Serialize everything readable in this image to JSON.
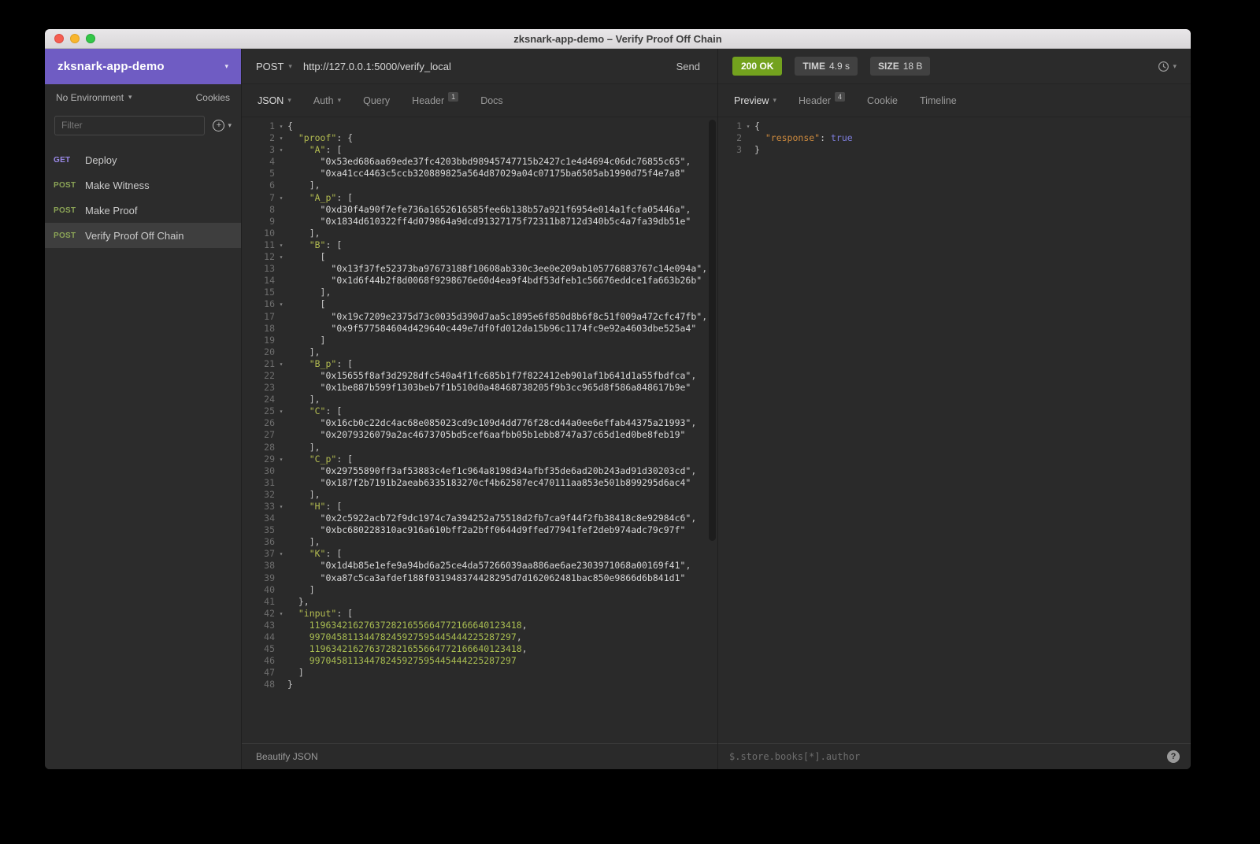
{
  "colors": {
    "accent_purple": "#6f5cc3",
    "method_get": "#9a89e8",
    "method_post": "#8ba456",
    "status_green": "#73a21e",
    "editor_key": "#b4bd51",
    "editor_string": "#d8d8d8",
    "editor_number": "#a9bd51",
    "editor_punct": "#c4c4c4",
    "response_key": "#cf8b3e",
    "response_bool": "#7d7ddc"
  },
  "window": {
    "title": "zksnark-app-demo – Verify Proof Off Chain"
  },
  "sidebar": {
    "workspace": "zksnark-app-demo",
    "environment": "No Environment",
    "cookies": "Cookies",
    "filter_placeholder": "Filter",
    "requests": [
      {
        "method": "GET",
        "name": "Deploy"
      },
      {
        "method": "POST",
        "name": "Make Witness"
      },
      {
        "method": "POST",
        "name": "Make Proof"
      },
      {
        "method": "POST",
        "name": "Verify Proof Off Chain"
      }
    ]
  },
  "request_panel": {
    "method": "POST",
    "url": "http://127.0.0.1:5000/verify_local",
    "send": "Send",
    "tabs": [
      {
        "label": "JSON"
      },
      {
        "label": "Auth"
      },
      {
        "label": "Query"
      },
      {
        "label": "Header",
        "badge": "1"
      },
      {
        "label": "Docs"
      }
    ],
    "beautify": "Beautify JSON",
    "body_lines": [
      {
        "num": 1,
        "f": true,
        "t": [
          [
            "p",
            "{"
          ]
        ]
      },
      {
        "num": 2,
        "f": true,
        "t": [
          [
            "ws",
            "  "
          ],
          [
            "k",
            "\"proof\""
          ],
          [
            "p",
            ": {"
          ]
        ]
      },
      {
        "num": 3,
        "f": true,
        "t": [
          [
            "ws",
            "    "
          ],
          [
            "k",
            "\"A\""
          ],
          [
            "p",
            ": ["
          ]
        ]
      },
      {
        "num": 4,
        "t": [
          [
            "ws",
            "      "
          ],
          [
            "s",
            "\"0x53ed686aa69ede37fc4203bbd98945747715b2427c1e4d4694c06dc76855c65\""
          ],
          [
            "p",
            ","
          ]
        ]
      },
      {
        "num": 5,
        "t": [
          [
            "ws",
            "      "
          ],
          [
            "s",
            "\"0xa41cc4463c5ccb320889825a564d87029a04c07175ba6505ab1990d75f4e7a8\""
          ]
        ]
      },
      {
        "num": 6,
        "t": [
          [
            "ws",
            "    "
          ],
          [
            "p",
            "],"
          ]
        ]
      },
      {
        "num": 7,
        "f": true,
        "t": [
          [
            "ws",
            "    "
          ],
          [
            "k",
            "\"A_p\""
          ],
          [
            "p",
            ": ["
          ]
        ]
      },
      {
        "num": 8,
        "t": [
          [
            "ws",
            "      "
          ],
          [
            "s",
            "\"0xd30f4a90f7efe736a1652616585fee6b138b57a921f6954e014a1fcfa05446a\""
          ],
          [
            "p",
            ","
          ]
        ]
      },
      {
        "num": 9,
        "t": [
          [
            "ws",
            "      "
          ],
          [
            "s",
            "\"0x1834d610322ff4d079864a9dcd91327175f72311b8712d340b5c4a7fa39db51e\""
          ]
        ]
      },
      {
        "num": 10,
        "t": [
          [
            "ws",
            "    "
          ],
          [
            "p",
            "],"
          ]
        ]
      },
      {
        "num": 11,
        "f": true,
        "t": [
          [
            "ws",
            "    "
          ],
          [
            "k",
            "\"B\""
          ],
          [
            "p",
            ": ["
          ]
        ]
      },
      {
        "num": 12,
        "f": true,
        "t": [
          [
            "ws",
            "      "
          ],
          [
            "p",
            "["
          ]
        ]
      },
      {
        "num": 13,
        "t": [
          [
            "ws",
            "        "
          ],
          [
            "s",
            "\"0x13f37fe52373ba97673188f10608ab330c3ee0e209ab105776883767c14e094a\""
          ],
          [
            "p",
            ","
          ]
        ]
      },
      {
        "num": 14,
        "t": [
          [
            "ws",
            "        "
          ],
          [
            "s",
            "\"0x1d6f44b2f8d0068f9298676e60d4ea9f4bdf53dfeb1c56676eddce1fa663b26b\""
          ]
        ]
      },
      {
        "num": 15,
        "t": [
          [
            "ws",
            "      "
          ],
          [
            "p",
            "],"
          ]
        ]
      },
      {
        "num": 16,
        "f": true,
        "t": [
          [
            "ws",
            "      "
          ],
          [
            "p",
            "["
          ]
        ]
      },
      {
        "num": 17,
        "t": [
          [
            "ws",
            "        "
          ],
          [
            "s",
            "\"0x19c7209e2375d73c0035d390d7aa5c1895e6f850d8b6f8c51f009a472cfc47fb\""
          ],
          [
            "p",
            ","
          ]
        ]
      },
      {
        "num": 18,
        "t": [
          [
            "ws",
            "        "
          ],
          [
            "s",
            "\"0x9f577584604d429640c449e7df0fd012da15b96c1174fc9e92a4603dbe525a4\""
          ]
        ]
      },
      {
        "num": 19,
        "t": [
          [
            "ws",
            "      "
          ],
          [
            "p",
            "]"
          ]
        ]
      },
      {
        "num": 20,
        "t": [
          [
            "ws",
            "    "
          ],
          [
            "p",
            "],"
          ]
        ]
      },
      {
        "num": 21,
        "f": true,
        "t": [
          [
            "ws",
            "    "
          ],
          [
            "k",
            "\"B_p\""
          ],
          [
            "p",
            ": ["
          ]
        ]
      },
      {
        "num": 22,
        "t": [
          [
            "ws",
            "      "
          ],
          [
            "s",
            "\"0x15655f8af3d2928dfc540a4f1fc685b1f7f822412eb901af1b641d1a55fbdfca\""
          ],
          [
            "p",
            ","
          ]
        ]
      },
      {
        "num": 23,
        "t": [
          [
            "ws",
            "      "
          ],
          [
            "s",
            "\"0x1be887b599f1303beb7f1b510d0a48468738205f9b3cc965d8f586a848617b9e\""
          ]
        ]
      },
      {
        "num": 24,
        "t": [
          [
            "ws",
            "    "
          ],
          [
            "p",
            "],"
          ]
        ]
      },
      {
        "num": 25,
        "f": true,
        "t": [
          [
            "ws",
            "    "
          ],
          [
            "k",
            "\"C\""
          ],
          [
            "p",
            ": ["
          ]
        ]
      },
      {
        "num": 26,
        "t": [
          [
            "ws",
            "      "
          ],
          [
            "s",
            "\"0x16cb0c22dc4ac68e085023cd9c109d4dd776f28cd44a0ee6effab44375a21993\""
          ],
          [
            "p",
            ","
          ]
        ]
      },
      {
        "num": 27,
        "t": [
          [
            "ws",
            "      "
          ],
          [
            "s",
            "\"0x2079326079a2ac4673705bd5cef6aafbb05b1ebb8747a37c65d1ed0be8feb19\""
          ]
        ]
      },
      {
        "num": 28,
        "t": [
          [
            "ws",
            "    "
          ],
          [
            "p",
            "],"
          ]
        ]
      },
      {
        "num": 29,
        "f": true,
        "t": [
          [
            "ws",
            "    "
          ],
          [
            "k",
            "\"C_p\""
          ],
          [
            "p",
            ": ["
          ]
        ]
      },
      {
        "num": 30,
        "t": [
          [
            "ws",
            "      "
          ],
          [
            "s",
            "\"0x29755890ff3af53883c4ef1c964a8198d34afbf35de6ad20b243ad91d30203cd\""
          ],
          [
            "p",
            ","
          ]
        ]
      },
      {
        "num": 31,
        "t": [
          [
            "ws",
            "      "
          ],
          [
            "s",
            "\"0x187f2b7191b2aeab6335183270cf4b62587ec470111aa853e501b899295d6ac4\""
          ]
        ]
      },
      {
        "num": 32,
        "t": [
          [
            "ws",
            "    "
          ],
          [
            "p",
            "],"
          ]
        ]
      },
      {
        "num": 33,
        "f": true,
        "t": [
          [
            "ws",
            "    "
          ],
          [
            "k",
            "\"H\""
          ],
          [
            "p",
            ": ["
          ]
        ]
      },
      {
        "num": 34,
        "t": [
          [
            "ws",
            "      "
          ],
          [
            "s",
            "\"0x2c5922acb72f9dc1974c7a394252a75518d2fb7ca9f44f2fb38418c8e92984c6\""
          ],
          [
            "p",
            ","
          ]
        ]
      },
      {
        "num": 35,
        "t": [
          [
            "ws",
            "      "
          ],
          [
            "s",
            "\"0xbc680228310ac916a610bff2a2bff0644d9ffed77941fef2deb974adc79c97f\""
          ]
        ]
      },
      {
        "num": 36,
        "t": [
          [
            "ws",
            "    "
          ],
          [
            "p",
            "],"
          ]
        ]
      },
      {
        "num": 37,
        "f": true,
        "t": [
          [
            "ws",
            "    "
          ],
          [
            "k",
            "\"K\""
          ],
          [
            "p",
            ": ["
          ]
        ]
      },
      {
        "num": 38,
        "t": [
          [
            "ws",
            "      "
          ],
          [
            "s",
            "\"0x1d4b85e1efe9a94bd6a25ce4da57266039aa886ae6ae2303971068a00169f41\""
          ],
          [
            "p",
            ","
          ]
        ]
      },
      {
        "num": 39,
        "t": [
          [
            "ws",
            "      "
          ],
          [
            "s",
            "\"0xa87c5ca3afdef188f031948374428295d7d162062481bac850e9866d6b841d1\""
          ]
        ]
      },
      {
        "num": 40,
        "t": [
          [
            "ws",
            "    "
          ],
          [
            "p",
            "]"
          ]
        ]
      },
      {
        "num": 41,
        "t": [
          [
            "ws",
            "  "
          ],
          [
            "p",
            "},"
          ]
        ]
      },
      {
        "num": 42,
        "f": true,
        "t": [
          [
            "ws",
            "  "
          ],
          [
            "k",
            "\"input\""
          ],
          [
            "p",
            ": ["
          ]
        ]
      },
      {
        "num": 43,
        "t": [
          [
            "ws",
            "    "
          ],
          [
            "n",
            "119634216276372821655664772166640123418"
          ],
          [
            "p",
            ","
          ]
        ]
      },
      {
        "num": 44,
        "t": [
          [
            "ws",
            "    "
          ],
          [
            "n",
            "99704581134478245927595445444225287297"
          ],
          [
            "p",
            ","
          ]
        ]
      },
      {
        "num": 45,
        "t": [
          [
            "ws",
            "    "
          ],
          [
            "n",
            "119634216276372821655664772166640123418"
          ],
          [
            "p",
            ","
          ]
        ]
      },
      {
        "num": 46,
        "t": [
          [
            "ws",
            "    "
          ],
          [
            "n",
            "99704581134478245927595445444225287297"
          ]
        ]
      },
      {
        "num": 47,
        "t": [
          [
            "ws",
            "  "
          ],
          [
            "p",
            "]"
          ]
        ]
      },
      {
        "num": 48,
        "t": [
          [
            "p",
            "}"
          ]
        ]
      }
    ]
  },
  "response_panel": {
    "status": "200 OK",
    "time": {
      "label": "TIME",
      "value": "4.9 s"
    },
    "size": {
      "label": "SIZE",
      "value": "18 B"
    },
    "tabs": [
      {
        "label": "Preview"
      },
      {
        "label": "Header",
        "badge": "4"
      },
      {
        "label": "Cookie"
      },
      {
        "label": "Timeline"
      }
    ],
    "body_lines": [
      {
        "num": 1,
        "f": true,
        "t": [
          [
            "p",
            "{"
          ]
        ]
      },
      {
        "num": 2,
        "t": [
          [
            "ws",
            "  "
          ],
          [
            "k",
            "\"response\""
          ],
          [
            "p",
            ": "
          ],
          [
            "b",
            "true"
          ]
        ]
      },
      {
        "num": 3,
        "t": [
          [
            "p",
            "}"
          ]
        ]
      }
    ],
    "filter_placeholder": "$.store.books[*].author"
  }
}
